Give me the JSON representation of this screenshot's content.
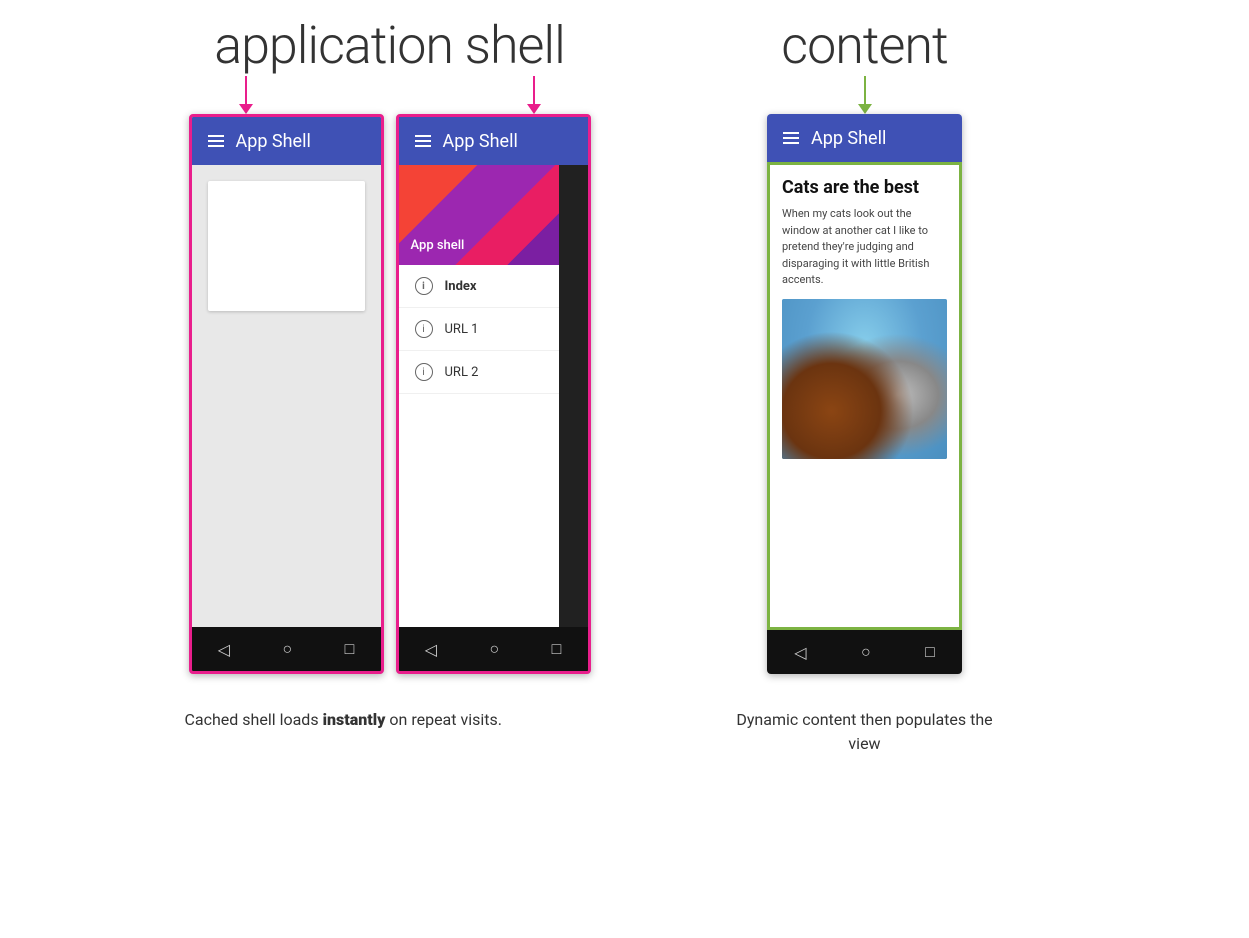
{
  "page": {
    "background": "#ffffff"
  },
  "labels": {
    "application_shell": "application shell",
    "content": "content"
  },
  "phone1": {
    "app_bar_title": "App Shell"
  },
  "phone2": {
    "app_bar_title": "App Shell",
    "drawer_header_title": "App shell",
    "drawer_items": [
      {
        "label": "Index",
        "active": true
      },
      {
        "label": "URL 1",
        "active": false
      },
      {
        "label": "URL 2",
        "active": false
      }
    ]
  },
  "phone3": {
    "app_bar_title": "App Shell",
    "content_title": "Cats are the best",
    "content_body": "When my cats look out the window at another cat I like to pretend they're judging and disparaging it with little British accents."
  },
  "captions": {
    "left_text": "Cached shell loads ",
    "left_bold": "instantly",
    "left_suffix": " on repeat visits.",
    "right_text": "Dynamic content then populates the view"
  },
  "nav_buttons": {
    "back": "◁",
    "home": "○",
    "recent": "□"
  }
}
